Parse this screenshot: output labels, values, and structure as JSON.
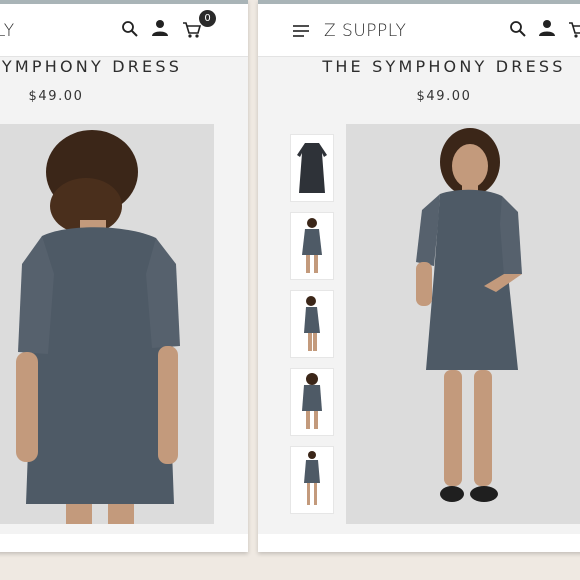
{
  "left_screen": {
    "brand_fragment": "LY",
    "product_title_fragment": "YMPHONY DRESS",
    "price": "$49.00",
    "cart_count": "0"
  },
  "right_screen": {
    "brand": "Z SUPPLY",
    "product_title": "THE SYMPHONY DRESS",
    "price": "$49.00"
  },
  "colors": {
    "dress": "#4e5a66",
    "background": "#efe9e2",
    "photo_bg": "#dcdcdc"
  }
}
